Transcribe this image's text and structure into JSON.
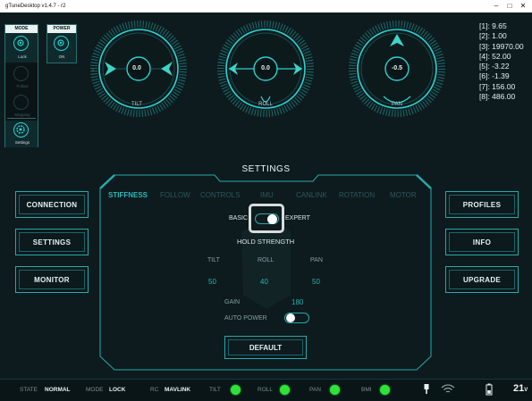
{
  "window": {
    "title": "gTuneDesktop  v1.4.7 - r2"
  },
  "mode_panel": {
    "header": "MODE",
    "items": [
      {
        "label": "Lock",
        "active": true
      },
      {
        "label": "Follow",
        "active": false
      },
      {
        "label": "Mapping",
        "active": false
      },
      {
        "label": "Settings",
        "active": true
      }
    ]
  },
  "power_panel": {
    "header": "POWER",
    "label": "ON"
  },
  "gauges": [
    {
      "label": "TILT",
      "value": "0.0"
    },
    {
      "label": "ROLL",
      "value": "0.0"
    },
    {
      "label": "PAN",
      "value": "-0.5"
    }
  ],
  "readouts": [
    "[1]: 9.65",
    "[2]: 1.00",
    "[3]: 19970.00",
    "[4]: 52.00",
    "[5]: -3.22",
    "[6]: -1.39",
    "[7]: 156.00",
    "[8]: 486.00"
  ],
  "left_buttons": [
    "CONNECTION",
    "SETTINGS",
    "MONITOR"
  ],
  "right_buttons": [
    "PROFILES",
    "INFO",
    "UPGRADE"
  ],
  "settings": {
    "title": "SETTINGS",
    "tabs": [
      "STIFFNESS",
      "FOLLOW",
      "CONTROLS",
      "IMU",
      "CANLINK",
      "ROTATION",
      "MOTOR"
    ],
    "active_tab": "STIFFNESS",
    "basic_label": "BASIC",
    "expert_label": "EXPERT",
    "hold_strength_label": "HOLD STRENGTH",
    "axes": [
      {
        "label": "TILT",
        "value": "50"
      },
      {
        "label": "ROLL",
        "value": "40"
      },
      {
        "label": "PAN",
        "value": "50"
      }
    ],
    "gain_label": "GAIN",
    "gain_value": "180",
    "auto_power_label": "AUTO POWER",
    "default_label": "DEFAULT"
  },
  "status_bar": {
    "state_key": "STATE",
    "state_value": "NORMAL",
    "mode_key": "MODE",
    "mode_value": "LOCK",
    "rc_key": "RC",
    "rc_value": "MAVLINK",
    "tilt": "TILT",
    "roll": "ROLL",
    "pan": "PAN",
    "bmi": "BMI",
    "voltage": "21",
    "voltage_unit": "V",
    "led_color": "#2ee23a"
  },
  "accent_color": "#29d4d3"
}
